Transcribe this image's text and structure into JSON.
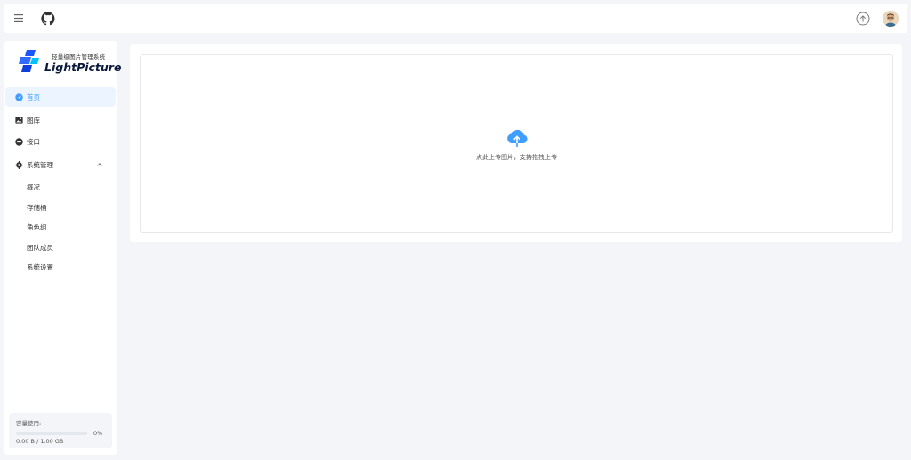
{
  "brand": {
    "subtitle": "轻量级图片管理系统",
    "name": "LightPicture"
  },
  "colors": {
    "accent": "#409eff",
    "active_bg": "#ecf5ff"
  },
  "topbar": {
    "menu_icon": "menu-icon",
    "github_icon": "github-icon",
    "upload_icon": "upload-circle-icon",
    "avatar_icon": "user-avatar"
  },
  "sidebar": {
    "items": [
      {
        "label": "首页",
        "icon": "dashboard-icon",
        "active": true
      },
      {
        "label": "图库",
        "icon": "image-icon",
        "active": false
      },
      {
        "label": "接口",
        "icon": "api-icon",
        "active": false
      },
      {
        "label": "系统管理",
        "icon": "gear-icon",
        "active": false,
        "expanded": true
      }
    ],
    "sub_items": [
      {
        "label": "概况"
      },
      {
        "label": "存储桶"
      },
      {
        "label": "角色组"
      },
      {
        "label": "团队成员"
      },
      {
        "label": "系统设置"
      }
    ]
  },
  "usage": {
    "title": "容量使用:",
    "percent": "0%",
    "fraction": 0,
    "size": "0.00 B / 1.00 GB"
  },
  "upload": {
    "text": "点此上传图片，支持拖拽上传",
    "icon": "cloud-upload-icon"
  }
}
